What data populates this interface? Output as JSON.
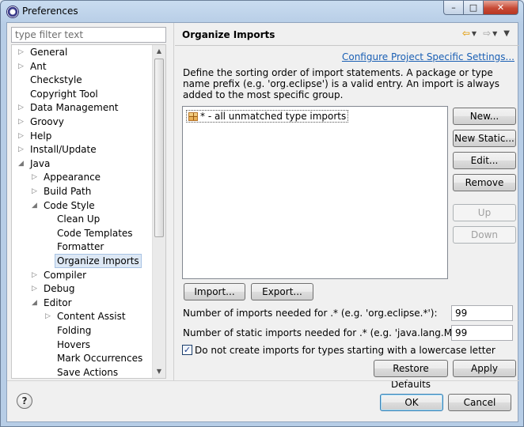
{
  "window": {
    "title": "Preferences",
    "min_label": "–",
    "max_label": "□",
    "close_label": "✕"
  },
  "filter": {
    "placeholder": "type filter text"
  },
  "tree": [
    {
      "label": "General",
      "arrow": "▷",
      "level": 0
    },
    {
      "label": "Ant",
      "arrow": "▷",
      "level": 0
    },
    {
      "label": "Checkstyle",
      "arrow": "",
      "level": 0
    },
    {
      "label": "Copyright Tool",
      "arrow": "",
      "level": 0
    },
    {
      "label": "Data Management",
      "arrow": "▷",
      "level": 0
    },
    {
      "label": "Groovy",
      "arrow": "▷",
      "level": 0
    },
    {
      "label": "Help",
      "arrow": "▷",
      "level": 0
    },
    {
      "label": "Install/Update",
      "arrow": "▷",
      "level": 0
    },
    {
      "label": "Java",
      "arrow": "◢",
      "level": 0
    },
    {
      "label": "Appearance",
      "arrow": "▷",
      "level": 1
    },
    {
      "label": "Build Path",
      "arrow": "▷",
      "level": 1
    },
    {
      "label": "Code Style",
      "arrow": "◢",
      "level": 1
    },
    {
      "label": "Clean Up",
      "arrow": "",
      "level": 2
    },
    {
      "label": "Code Templates",
      "arrow": "",
      "level": 2
    },
    {
      "label": "Formatter",
      "arrow": "",
      "level": 2
    },
    {
      "label": "Organize Imports",
      "arrow": "",
      "level": 2,
      "selected": true
    },
    {
      "label": "Compiler",
      "arrow": "▷",
      "level": 1
    },
    {
      "label": "Debug",
      "arrow": "▷",
      "level": 1
    },
    {
      "label": "Editor",
      "arrow": "◢",
      "level": 1
    },
    {
      "label": "Content Assist",
      "arrow": "▷",
      "level": 2
    },
    {
      "label": "Folding",
      "arrow": "",
      "level": 2
    },
    {
      "label": "Hovers",
      "arrow": "",
      "level": 2
    },
    {
      "label": "Mark Occurrences",
      "arrow": "",
      "level": 2
    },
    {
      "label": "Save Actions",
      "arrow": "",
      "level": 2
    }
  ],
  "page": {
    "title": "Organize Imports",
    "configure_link": "Configure Project Specific Settings...",
    "description": "Define the sorting order of import statements. A package or type name prefix (e.g. 'org.eclipse') is a valid entry. An import is always added to the most specific group.",
    "list_items": [
      "* - all unmatched type imports"
    ],
    "buttons": {
      "new": "New...",
      "new_static": "New Static...",
      "edit": "Edit...",
      "remove": "Remove",
      "up": "Up",
      "down": "Down",
      "import": "Import...",
      "export": "Export..."
    },
    "imports_label": "Number of imports needed for .* (e.g. 'org.eclipse.*'):",
    "imports_value": "99",
    "static_label": "Number of static imports needed for .* (e.g. 'java.lang.Math.*'):",
    "static_value": "99",
    "lowercase_label": "Do not create imports for types starting with a lowercase letter",
    "lowercase_checked": true,
    "restore_defaults": "Restore Defaults",
    "apply": "Apply"
  },
  "footer": {
    "help_label": "?",
    "ok": "OK",
    "cancel": "Cancel"
  },
  "icons": {
    "back": "back-arrow-icon",
    "forward": "forward-arrow-icon",
    "menu": "view-menu-icon"
  }
}
